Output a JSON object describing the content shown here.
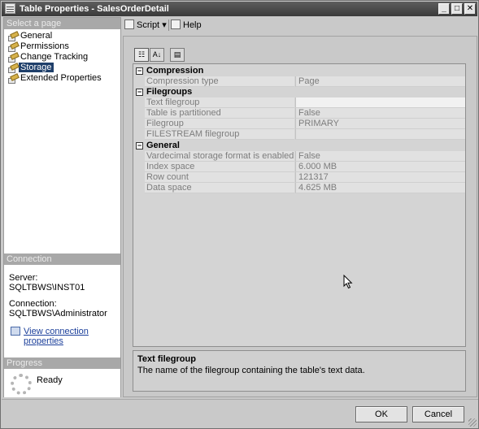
{
  "window": {
    "title": "Table Properties - SalesOrderDetail",
    "controls": {
      "minimize": "_",
      "maximize": "□",
      "close": "✕"
    }
  },
  "sidebar": {
    "select_page_header": "Select a page",
    "pages": [
      {
        "label": "General",
        "icon": "page-icon"
      },
      {
        "label": "Permissions",
        "icon": "page-icon"
      },
      {
        "label": "Change Tracking",
        "icon": "page-icon"
      },
      {
        "label": "Storage",
        "icon": "page-icon",
        "selected": true
      },
      {
        "label": "Extended Properties",
        "icon": "page-icon"
      }
    ],
    "connection": {
      "header": "Connection",
      "server_label": "Server:",
      "server_value": "SQLTBWS\\INST01",
      "connection_label": "Connection:",
      "connection_value": "SQLTBWS\\Administrator",
      "view_link": "View connection properties"
    },
    "progress": {
      "header": "Progress",
      "status": "Ready"
    }
  },
  "toolbar": {
    "script_label": "Script",
    "help_label": "Help"
  },
  "grid": {
    "categories": [
      {
        "label": "Compression",
        "toggle": "−",
        "properties": [
          {
            "name": "Compression type",
            "value": "Page"
          }
        ]
      },
      {
        "label": "Filegroups",
        "toggle": "−",
        "properties": [
          {
            "name": "Text filegroup",
            "value": "",
            "selected": true
          },
          {
            "name": "Table is partitioned",
            "value": "False"
          },
          {
            "name": "Filegroup",
            "value": "PRIMARY"
          },
          {
            "name": "FILESTREAM filegroup",
            "value": ""
          }
        ]
      },
      {
        "label": "General",
        "toggle": "−",
        "properties": [
          {
            "name": "Vardecimal storage format is enabled",
            "value": "False"
          },
          {
            "name": "Index space",
            "value": "6.000 MB"
          },
          {
            "name": "Row count",
            "value": "121317"
          },
          {
            "name": "Data space",
            "value": "4.625 MB"
          }
        ]
      }
    ]
  },
  "description": {
    "title": "Text filegroup",
    "text": "The name of the filegroup containing the table's text data."
  },
  "buttons": {
    "ok": "OK",
    "cancel": "Cancel"
  }
}
